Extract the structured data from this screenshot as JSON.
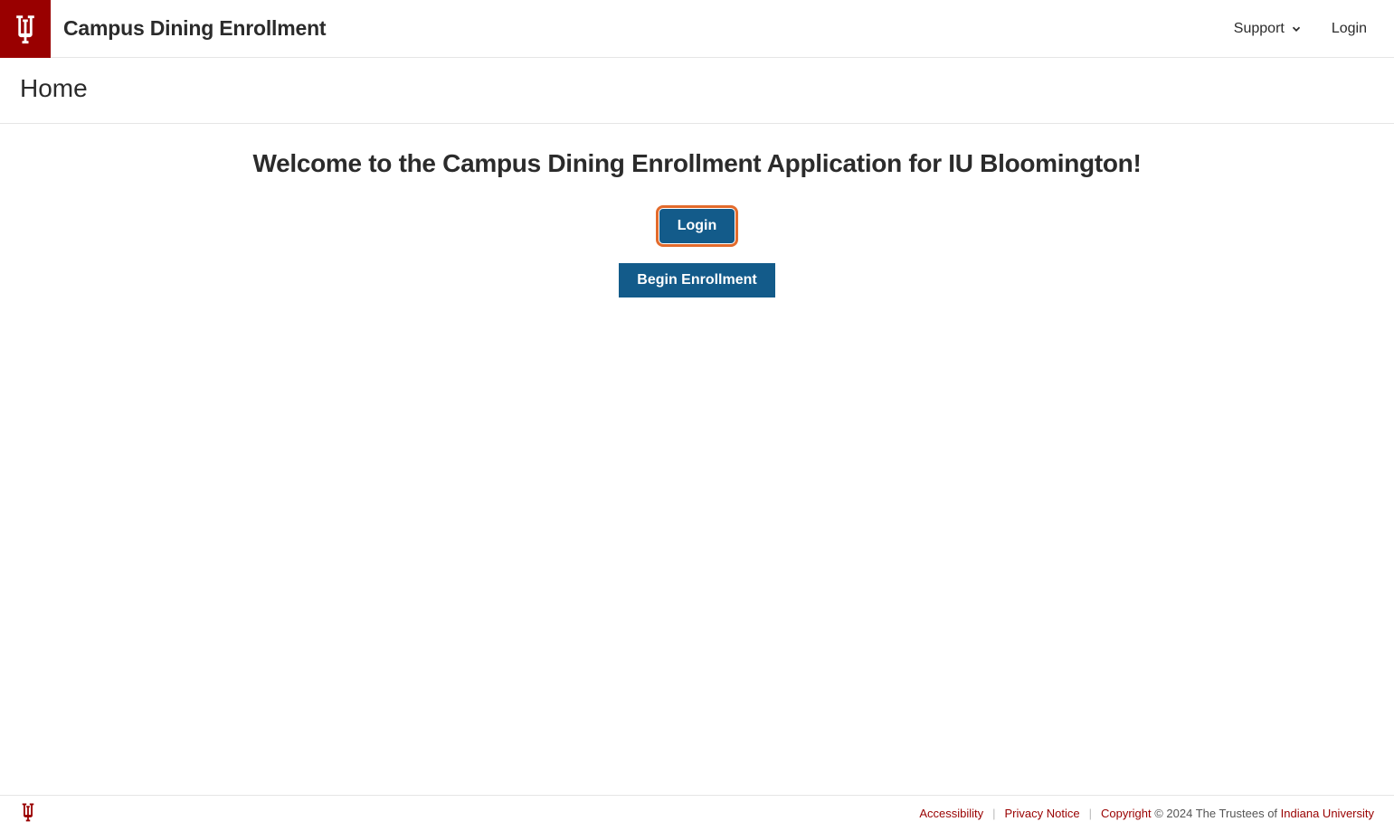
{
  "header": {
    "app_title": "Campus Dining Enrollment",
    "nav": {
      "support": "Support",
      "login": "Login"
    }
  },
  "subheader": {
    "page_title": "Home"
  },
  "main": {
    "welcome_heading": "Welcome to the Campus Dining Enrollment Application for IU Bloomington!",
    "login_button": "Login",
    "begin_enrollment_button": "Begin Enrollment"
  },
  "footer": {
    "accessibility": "Accessibility",
    "privacy": "Privacy Notice",
    "copyright_link": "Copyright",
    "copyright_text": " © 2024 The Trustees of ",
    "iu_link": "Indiana University",
    "sep": "|"
  },
  "colors": {
    "brand_red": "#990000",
    "button_blue": "#135b8a",
    "focus_orange": "#e36b2c"
  }
}
